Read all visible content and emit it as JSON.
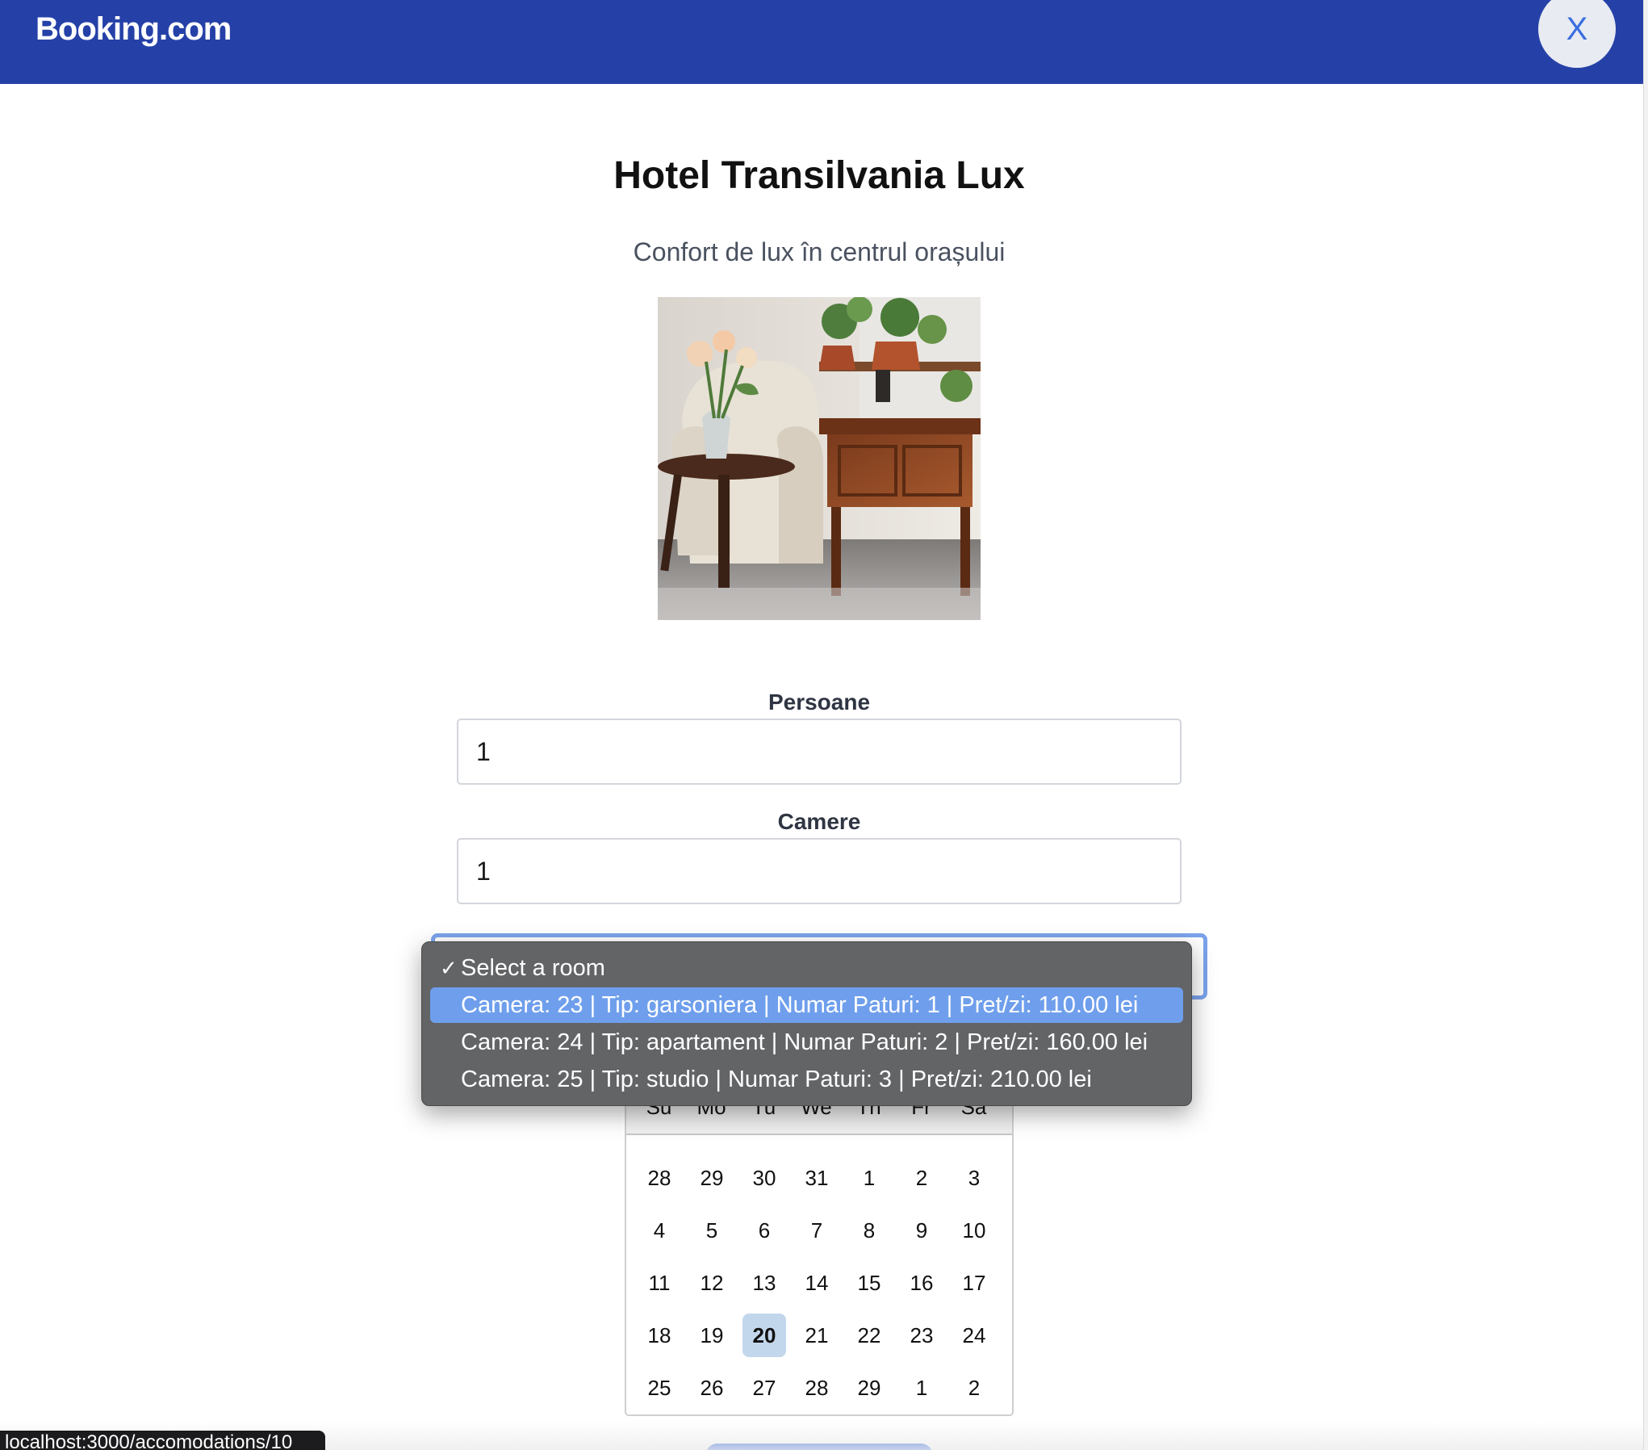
{
  "header": {
    "brand": "Booking.com",
    "close_label": "X",
    "colors": {
      "bar": "#2541a8",
      "close_text": "#3b6fe0"
    }
  },
  "hotel": {
    "name": "Hotel Transilvania Lux",
    "subtitle": "Confort de lux în centrul orașului"
  },
  "form": {
    "persons_label": "Persoane",
    "persons_value": "1",
    "rooms_label": "Camere",
    "rooms_value": "1",
    "room_select": {
      "selected": "Select a room",
      "options": [
        "Select a room",
        "Camera: 23 | Tip: garsoniera | Numar Paturi: 1 | Pret/zi: 110.00 lei",
        "Camera: 24 | Tip: apartament | Numar Paturi: 2 | Pret/zi: 160.00 lei",
        "Camera: 25 | Tip: studio | Numar Paturi: 3 | Pret/zi: 210.00 lei"
      ],
      "highlighted_index": 1
    }
  },
  "calendar": {
    "weekdays": [
      "Su",
      "Mo",
      "Tu",
      "We",
      "Th",
      "Fr",
      "Sa"
    ],
    "weeks": [
      [
        "28",
        "29",
        "30",
        "31",
        "1",
        "2",
        "3"
      ],
      [
        "4",
        "5",
        "6",
        "7",
        "8",
        "9",
        "10"
      ],
      [
        "11",
        "12",
        "13",
        "14",
        "15",
        "16",
        "17"
      ],
      [
        "18",
        "19",
        "20",
        "21",
        "22",
        "23",
        "24"
      ],
      [
        "25",
        "26",
        "27",
        "28",
        "29",
        "1",
        "2"
      ]
    ],
    "today": "20"
  },
  "status_bar": {
    "url": "localhost:3000/accomodations/10"
  }
}
